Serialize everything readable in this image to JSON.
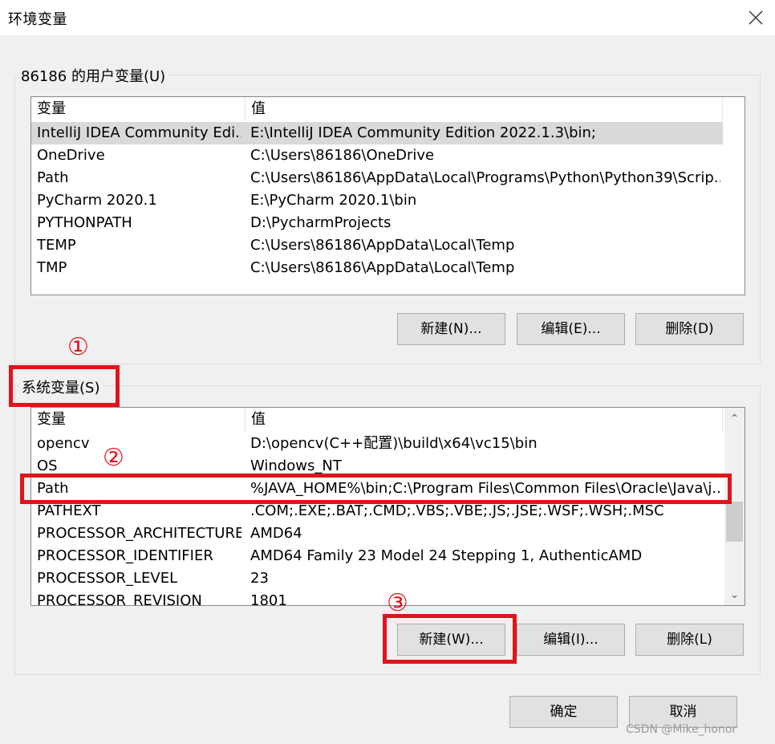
{
  "window": {
    "title": "环境变量",
    "close_icon": "close-icon"
  },
  "user_vars": {
    "group_label": "86186 的用户变量(U)",
    "columns": [
      "变量",
      "值"
    ],
    "rows": [
      {
        "name": "IntelliJ IDEA Community Edi...",
        "value": "E:\\IntelliJ IDEA Community Edition 2022.1.3\\bin;"
      },
      {
        "name": "OneDrive",
        "value": "C:\\Users\\86186\\OneDrive"
      },
      {
        "name": "Path",
        "value": "C:\\Users\\86186\\AppData\\Local\\Programs\\Python\\Python39\\Scrip..."
      },
      {
        "name": "PyCharm 2020.1",
        "value": "E:\\PyCharm 2020.1\\bin"
      },
      {
        "name": "PYTHONPATH",
        "value": "D:\\PycharmProjects"
      },
      {
        "name": "TEMP",
        "value": "C:\\Users\\86186\\AppData\\Local\\Temp"
      },
      {
        "name": "TMP",
        "value": "C:\\Users\\86186\\AppData\\Local\\Temp"
      }
    ],
    "buttons": {
      "new": "新建(N)...",
      "edit": "编辑(E)...",
      "delete": "删除(D)"
    }
  },
  "system_vars": {
    "group_label": "系统变量(S)",
    "columns": [
      "变量",
      "值"
    ],
    "rows": [
      {
        "name": "opencv",
        "value": "D:\\opencv(C++配置)\\build\\x64\\vc15\\bin"
      },
      {
        "name": "OS",
        "value": "Windows_NT"
      },
      {
        "name": "Path",
        "value": "%JAVA_HOME%\\bin;C:\\Program Files\\Common Files\\Oracle\\Java\\j..."
      },
      {
        "name": "PATHEXT",
        "value": ".COM;.EXE;.BAT;.CMD;.VBS;.VBE;.JS;.JSE;.WSF;.WSH;.MSC"
      },
      {
        "name": "PROCESSOR_ARCHITECTURE",
        "value": "AMD64"
      },
      {
        "name": "PROCESSOR_IDENTIFIER",
        "value": "AMD64 Family 23 Model 24 Stepping 1, AuthenticAMD"
      },
      {
        "name": "PROCESSOR_LEVEL",
        "value": "23"
      },
      {
        "name": "PROCESSOR_REVISION",
        "value": "1801"
      }
    ],
    "buttons": {
      "new": "新建(W)...",
      "edit": "编辑(I)...",
      "delete": "删除(L)"
    }
  },
  "dialog_buttons": {
    "ok": "确定",
    "cancel": "取消"
  },
  "annotations": [
    "①",
    "②",
    "③"
  ],
  "annotation_color": "#e0141b",
  "watermark": "CSDN @Mike_honor"
}
